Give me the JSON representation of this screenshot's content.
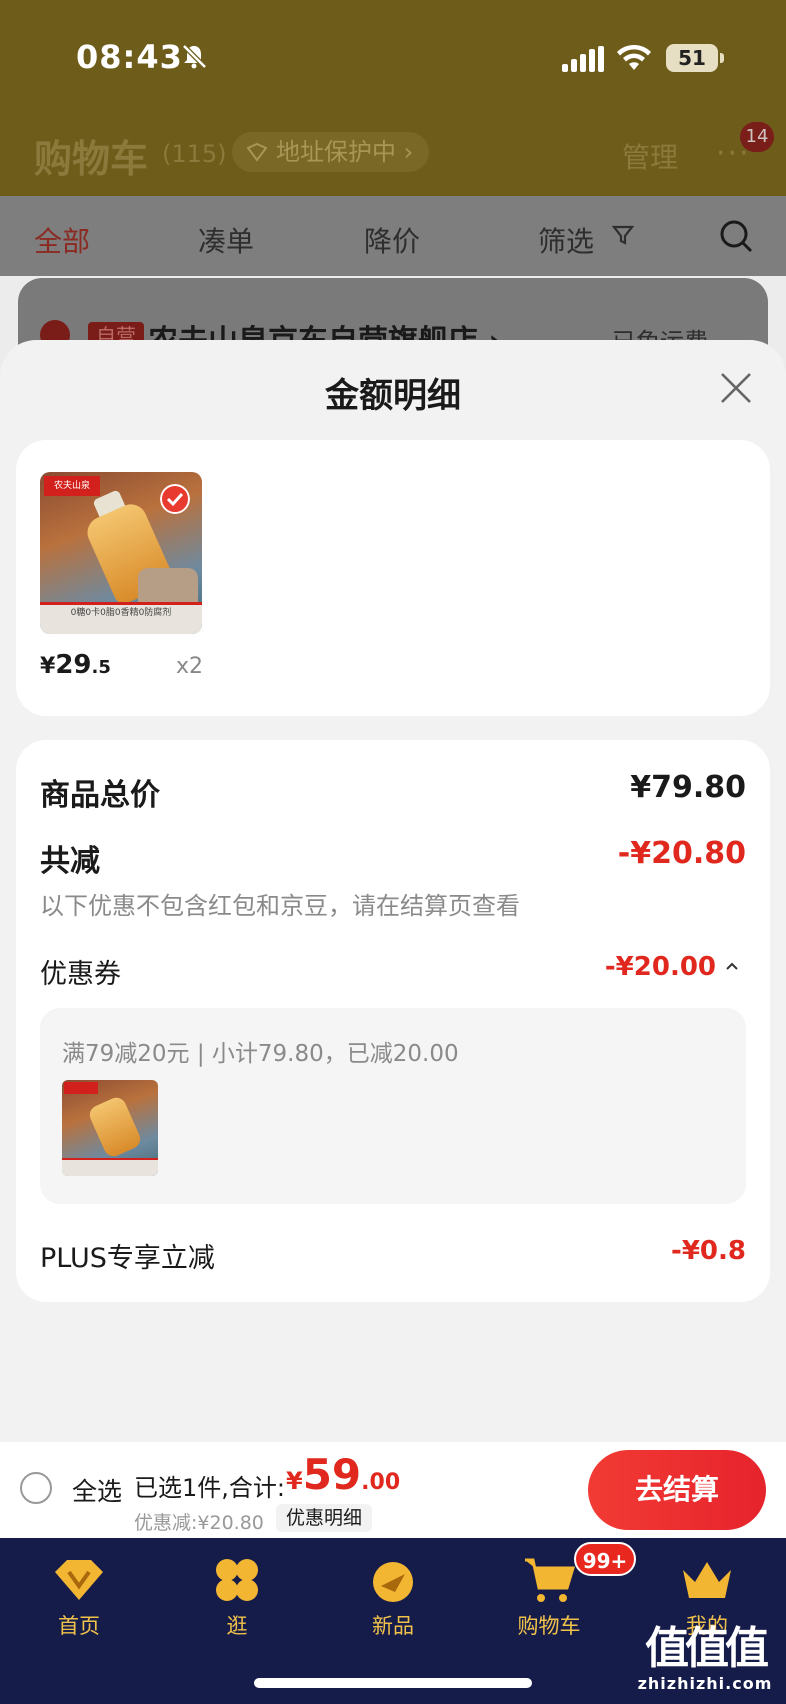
{
  "status_bar": {
    "time": "08:43",
    "battery": "51"
  },
  "cart_header": {
    "title": "购物车",
    "count": "(115)",
    "address_pill": "地址保护中 ›",
    "manage": "管理",
    "more": "···",
    "notification_badge": "14"
  },
  "filter_tabs": [
    "全部",
    "凑单",
    "降价",
    "筛选"
  ],
  "store": {
    "tag": "自营",
    "name": "农夫山泉京东自营旗舰店 ›",
    "shipping": "已免运费"
  },
  "sheet": {
    "title": "金额明细",
    "goods": {
      "thumb_logo": "农夫山泉",
      "thumb_banner": "0糖0卡0脂0香精0防腐剂",
      "price_symbol": "¥",
      "price_int": "29",
      "price_dec": ".5",
      "qty": "x2"
    },
    "summary": {
      "total_label": "商品总价",
      "total_value": "¥79.80",
      "reduce_label": "共减",
      "reduce_value": "-¥20.80",
      "note": "以下优惠不包含红包和京豆，请在结算页查看",
      "coupon_label": "优惠券",
      "coupon_value": "-¥20.00",
      "coupon_rule": "满79减20元 | 小计79.80，已减20.00",
      "plus_label": "PLUS专享立减",
      "plus_value": "-¥0.8"
    }
  },
  "checkout": {
    "select_all": "全选",
    "selected": "已选1件,合计:",
    "price_symbol": "¥",
    "price_int": "59",
    "price_dec": ".00",
    "discount": "优惠减:¥20.80",
    "detail_pill": "优惠明细",
    "button": "去结算"
  },
  "tab_bar": {
    "tabs": [
      "首页",
      "逛",
      "新品",
      "购物车",
      "我的"
    ],
    "cart_badge": "99+"
  },
  "watermark": {
    "glyph": "值值值",
    "url": "zhizhizhi.com"
  },
  "colors": {
    "accent_red": "#e0281e",
    "tab_bg": "#161c4a",
    "tab_label": "#f0c24a"
  }
}
